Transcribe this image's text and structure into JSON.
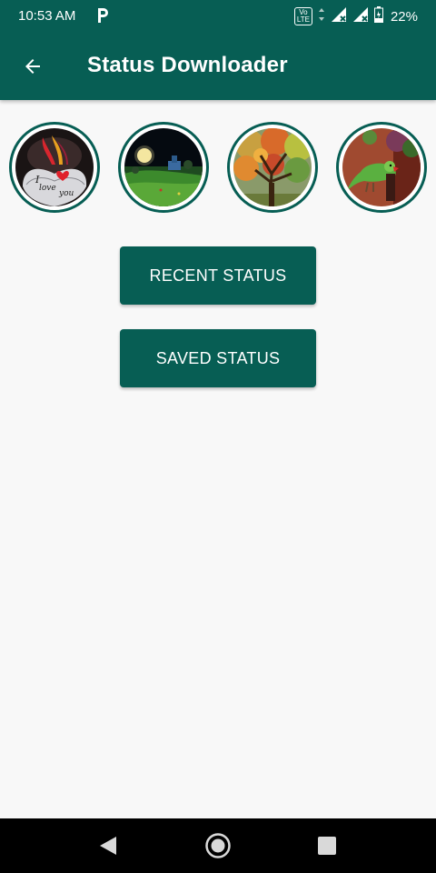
{
  "status_bar": {
    "time": "10:53 AM",
    "notification_icon": "p-icon",
    "volte_line1": "Vo",
    "volte_line2": "LTE",
    "battery_percent": "22%"
  },
  "app_bar": {
    "title": "Status Downloader",
    "back_icon": "arrow-left-icon"
  },
  "status_thumbnails": [
    {
      "subject": "i-love-you-heart"
    },
    {
      "subject": "night-moon-landscape"
    },
    {
      "subject": "autumn-tree"
    },
    {
      "subject": "green-parrot"
    }
  ],
  "buttons": {
    "recent_label": "RECENT STATUS",
    "saved_label": "SAVED STATUS"
  },
  "colors": {
    "primary": "#075e54",
    "background": "#f8f8f8",
    "nav_bar": "#000000"
  },
  "nav_bar": {
    "icons": [
      "triangle-back-icon",
      "circle-home-icon",
      "square-recents-icon"
    ]
  }
}
